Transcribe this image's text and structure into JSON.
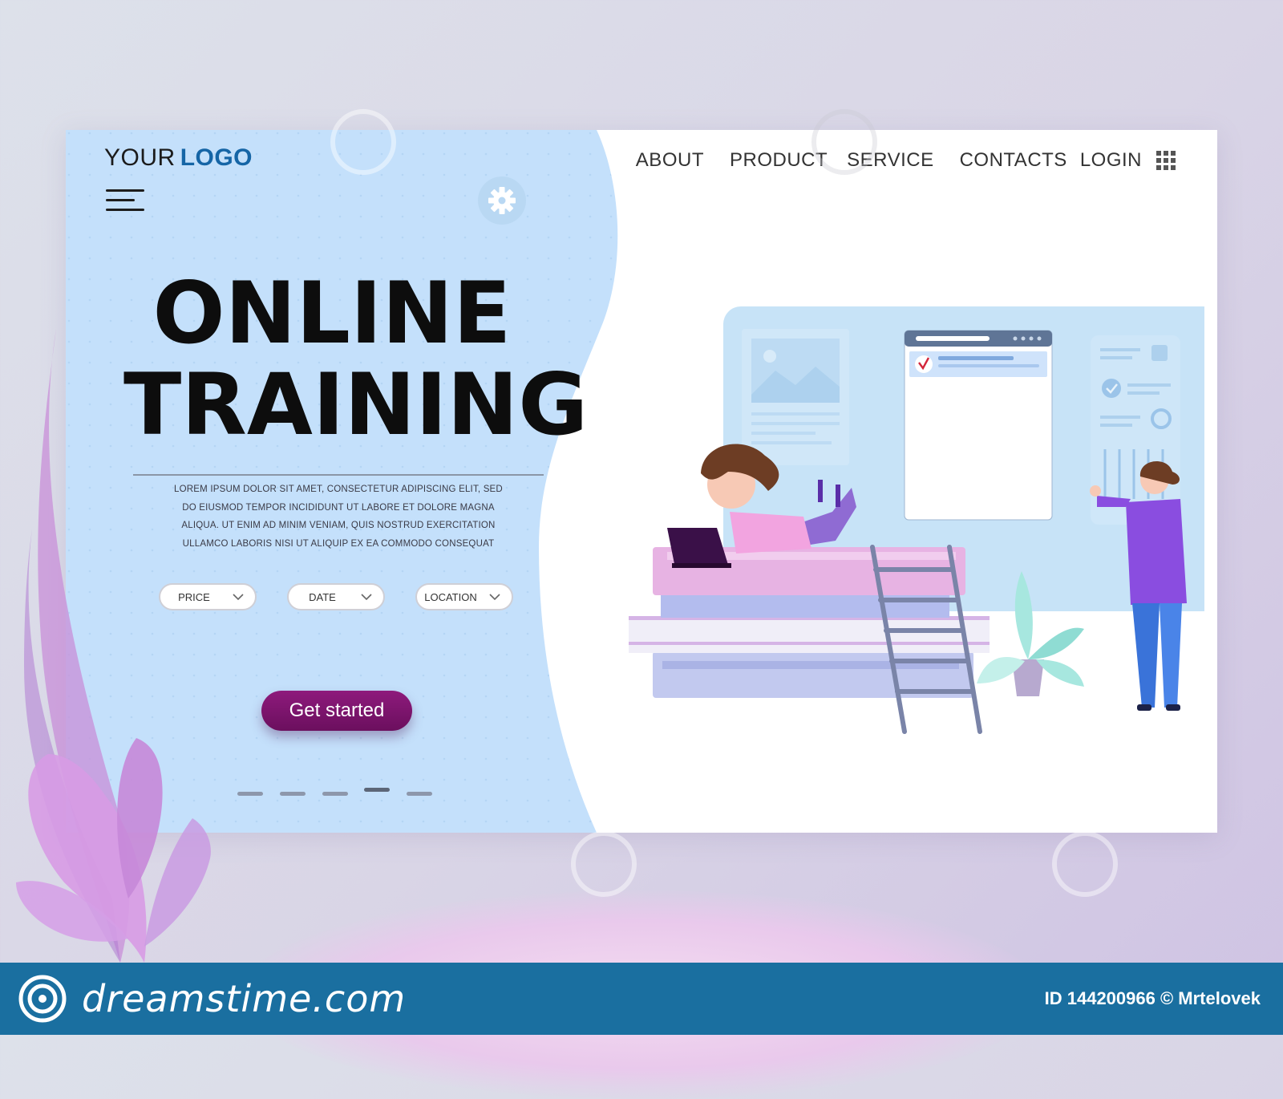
{
  "logo": {
    "prefix": "YOUR",
    "bold": "LOGO"
  },
  "nav": {
    "items": [
      {
        "label": "ABOUT"
      },
      {
        "label": "PRODUCT"
      },
      {
        "label": "SERVICE"
      },
      {
        "label": "CONTACTS"
      },
      {
        "label": "LOGIN"
      }
    ]
  },
  "hero": {
    "title_line1": "ONLINE",
    "title_line2": "TRAINING",
    "body": [
      "LOREM IPSUM DOLOR SIT AMET, CONSECTETUR ADIPISCING ELIT, SED",
      "DO EIUSMOD TEMPOR INCIDIDUNT UT LABORE ET DOLORE MAGNA",
      "ALIQUA. UT ENIM AD MINIM VENIAM, QUIS NOSTRUD EXERCITATION",
      "ULLAMCO LABORIS NISI UT ALIQUIP EX EA COMMODO CONSEQUAT"
    ]
  },
  "filters": [
    {
      "label": "PRICE"
    },
    {
      "label": "DATE"
    },
    {
      "label": "LOCATION"
    }
  ],
  "cta": {
    "label": "Get started"
  },
  "pager": {
    "count": 5,
    "active_index": 3
  },
  "footer": {
    "brand": "dreamstime.com",
    "credit": "ID 144200966 © Mrtelovek"
  },
  "colors": {
    "hero_blue": "#c4e0fb",
    "logo_accent": "#1565a6",
    "cta": "#7a1470",
    "footer": "#1a6fa0"
  }
}
